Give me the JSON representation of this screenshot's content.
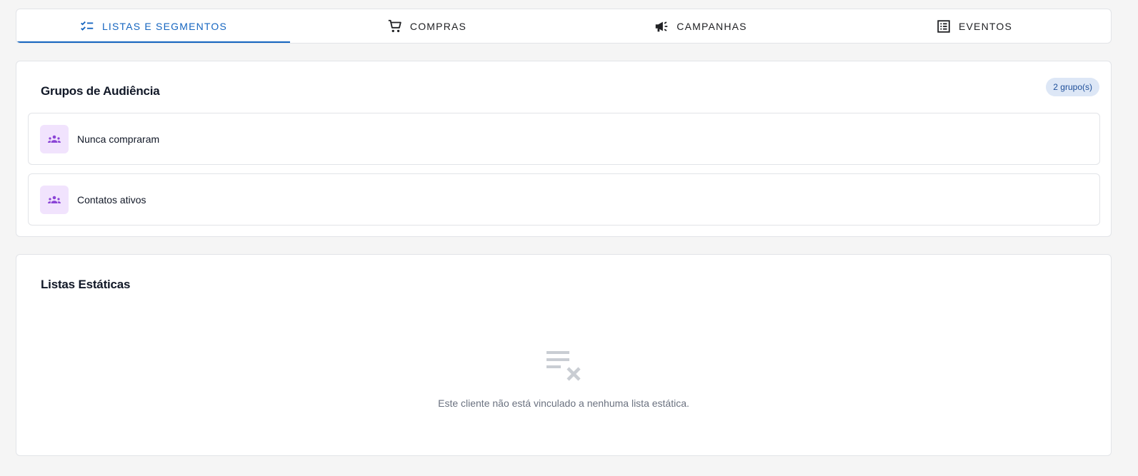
{
  "tabs": [
    {
      "label": "LISTAS E SEGMENTOS",
      "icon": "checklist-icon",
      "active": true
    },
    {
      "label": "COMPRAS",
      "icon": "cart-icon",
      "active": false
    },
    {
      "label": "CAMPANHAS",
      "icon": "megaphone-icon",
      "active": false
    },
    {
      "label": "EVENTOS",
      "icon": "list-alt-icon",
      "active": false
    }
  ],
  "groups": {
    "title": "Grupos de Audiência",
    "badge": "2 grupo(s)",
    "items": [
      {
        "label": "Nunca compraram",
        "icon": "groups-icon"
      },
      {
        "label": "Contatos ativos",
        "icon": "groups-icon"
      }
    ]
  },
  "static_lists": {
    "title": "Listas Estáticas",
    "empty_icon": "playlist-remove-icon",
    "empty_message": "Este cliente não está vinculado a nenhuma lista estática."
  },
  "colors": {
    "accent": "#1565c0",
    "badge_bg": "#dde7f6",
    "group_icon_bg": "#f1e3fd",
    "group_icon_fg": "#8b45d6",
    "empty_icon": "#c9cdd3"
  }
}
